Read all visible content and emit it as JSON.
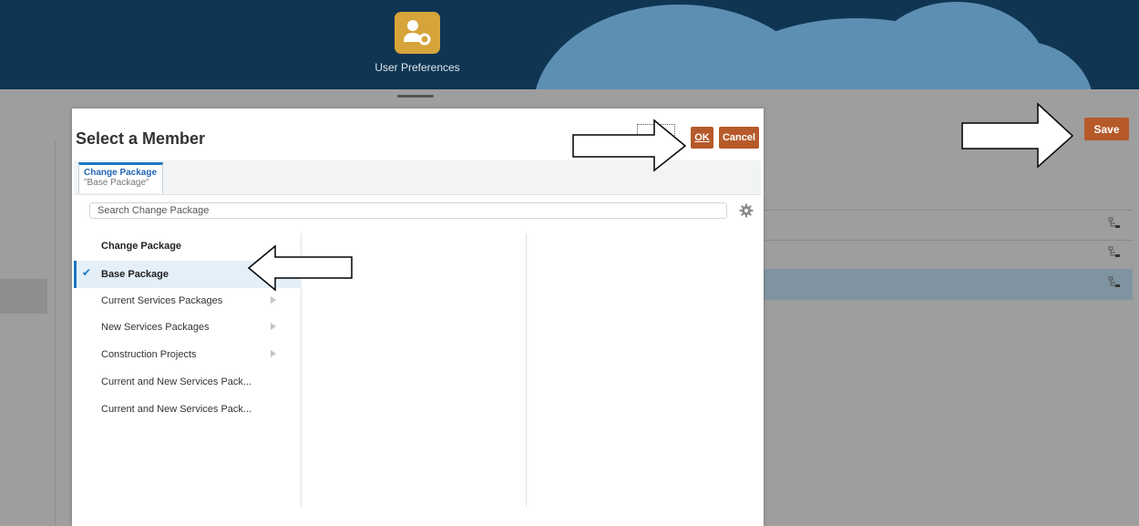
{
  "header": {
    "app_label": "User Preferences",
    "app_icon": "user-settings-icon",
    "accent": "#d6a43a",
    "background": "#0f3552"
  },
  "toolbar": {
    "save_label": "Save",
    "save_color": "#b65a2a"
  },
  "dialog": {
    "title": "Select a Member",
    "ok_label": "OK",
    "cancel_label": "Cancel",
    "tab": {
      "title": "Change Package",
      "subtitle": "\"Base Package\""
    },
    "search": {
      "placeholder": "Search Change Package",
      "value": ""
    },
    "column_header": "Change Package",
    "members": [
      {
        "label": "Base Package",
        "selected": true,
        "has_children": false
      },
      {
        "label": "Current Services Packages",
        "selected": false,
        "has_children": true
      },
      {
        "label": "New Services Packages",
        "selected": false,
        "has_children": true
      },
      {
        "label": "Construction Projects",
        "selected": false,
        "has_children": true
      },
      {
        "label": "Current and New Services Pack...",
        "selected": false,
        "has_children": false
      },
      {
        "label": "Current and New Services Pack...",
        "selected": false,
        "has_children": false
      }
    ]
  }
}
